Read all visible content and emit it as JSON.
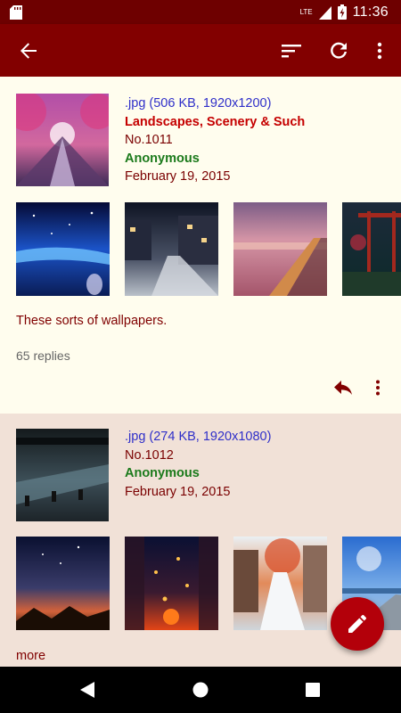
{
  "status": {
    "network_label": "LTE",
    "time": "11:36",
    "icons": [
      "sd-card-icon",
      "lte-signal-icon",
      "battery-charging-icon"
    ]
  },
  "toolbar": {
    "icons": [
      "back-arrow-icon",
      "sort-icon",
      "refresh-icon",
      "overflow-menu-icon"
    ]
  },
  "threads": [
    {
      "file": ".jpg (506 KB, 1920x1200)",
      "subject": "Landscapes, Scenery & Such",
      "number": "No.1011",
      "name": "Anonymous",
      "date": "February 19, 2015",
      "comment": "These sorts of wallpapers.",
      "replies": "65 replies"
    },
    {
      "file": ".jpg (274 KB, 1920x1080)",
      "number": "No.1012",
      "name": "Anonymous",
      "date": "February 19, 2015",
      "more": "more"
    }
  ],
  "fab": {
    "icon": "pencil-icon"
  },
  "nav": {
    "icons": [
      "nav-back-icon",
      "nav-home-icon",
      "nav-recents-icon"
    ]
  },
  "colors": {
    "statusbar": "#6e0000",
    "appbar": "#820000",
    "post_bg_1": "#fffdee",
    "post_bg_2": "#f1e1d7",
    "fab": "#b3000a",
    "subject": "#c50000",
    "name": "#1b7a1b",
    "file_link": "#2f2fc9"
  }
}
